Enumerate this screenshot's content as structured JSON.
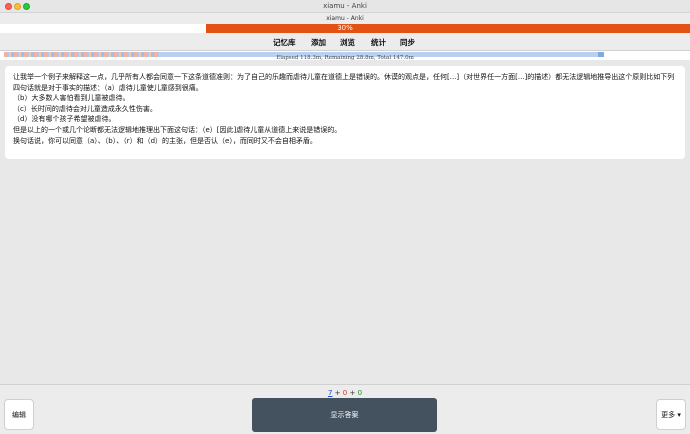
{
  "window": {
    "title": "xiamu - Anki"
  },
  "subtitle": "xiamu - Anki",
  "progress": {
    "label": "30%",
    "value": 0.3
  },
  "toolbar": {
    "items": [
      "记忆库",
      "添加",
      "浏览",
      "统计",
      "同步"
    ]
  },
  "timeline": {
    "label": "Elapsed 118.3m, Remaining 28.8m, Total 147.0m"
  },
  "card": {
    "paragraphs": [
      "让我举一个例子来解释这一点，几乎所有人都会同意一下这条道德准则：为了自己的乐趣而虐待儿童在道德上是错误的。休谟的观点是，任何[...]（对世界任一方面[...]的描述）都无法逻辑地推导出这个原则比如下列四句话就是对于事实的描述：（a）虐待儿童使儿童感到很痛。",
      "（b）大多数人害怕看到儿童被虐待。",
      "（c）长时间的虐待会对儿童造成永久性伤害。",
      "（d）没有哪个孩子希望被虐待。",
      "但是以上的一个或几个论断都无法逻辑地推理出下面这句话：（e）[因此]虐待儿童从道德上来说是错误的。",
      "换句话说，你可以同意（a）、（b）、（r）和（d）的主张，但是否认（e），而同时又不会自相矛盾。"
    ]
  },
  "bottom": {
    "counts": {
      "new": "7",
      "plus1": "+",
      "learn": "0",
      "plus2": "+",
      "review": "0"
    },
    "edit_label": "编辑",
    "show_answer_label": "显示答案",
    "more_label": "更多 ▾"
  }
}
